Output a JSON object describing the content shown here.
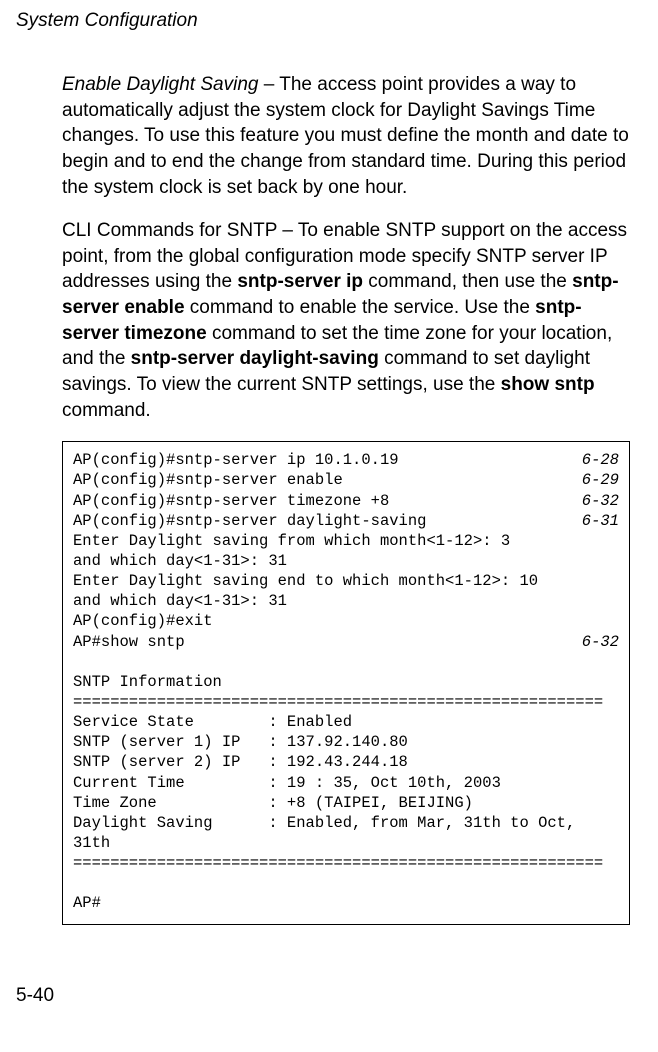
{
  "header": {
    "title": "System Configuration"
  },
  "para1": {
    "lead": "Enable Daylight Saving",
    "rest": " – The access point provides a way to automatically adjust the system clock for Daylight Savings Time changes. To use this feature you must define the month and date to begin and to end the change from standard time. During this period the system clock is set back by one hour."
  },
  "para2": {
    "t1": "CLI Commands for SNTP – To enable SNTP support on the access point, from the global configuration mode specify SNTP server IP addresses using the ",
    "b1": "sntp-server ip",
    "t2": " command, then use the ",
    "b2": "sntp-server enable",
    "t3": " command to enable the service. Use the ",
    "b3": "sntp-server timezone",
    "t4": " command to set the time zone for your location, and the ",
    "b4": "sntp-server daylight-saving",
    "t5": " command to set daylight savings. To view the current SNTP settings, use the ",
    "b5": "show sntp",
    "t6": " command."
  },
  "cli": {
    "rows": [
      {
        "cmd": "AP(config)#sntp-server ip 10.1.0.19",
        "ref": "6-28"
      },
      {
        "cmd": "AP(config)#sntp-server enable",
        "ref": "6-29"
      },
      {
        "cmd": "AP(config)#sntp-server timezone +8",
        "ref": "6-32"
      },
      {
        "cmd": "AP(config)#sntp-server daylight-saving",
        "ref": "6-31"
      }
    ],
    "lines1": [
      "Enter Daylight saving from which month<1-12>: 3",
      "and which day<1-31>: 31",
      "Enter Daylight saving end to which month<1-12>: 10",
      "and which day<1-31>: 31",
      "AP(config)#exit"
    ],
    "rowShow": {
      "cmd": "AP#show sntp",
      "ref": "6-32"
    },
    "lines2": [
      "",
      "SNTP Information",
      "=========================================================",
      "Service State        : Enabled",
      "SNTP (server 1) IP   : 137.92.140.80",
      "SNTP (server 2) IP   : 192.43.244.18",
      "Current Time         : 19 : 35, Oct 10th, 2003",
      "Time Zone            : +8 (TAIPEI, BEIJING)",
      "Daylight Saving      : Enabled, from Mar, 31th to Oct,",
      "31th",
      "=========================================================",
      "",
      "AP#"
    ]
  },
  "pageNumber": "5-40"
}
